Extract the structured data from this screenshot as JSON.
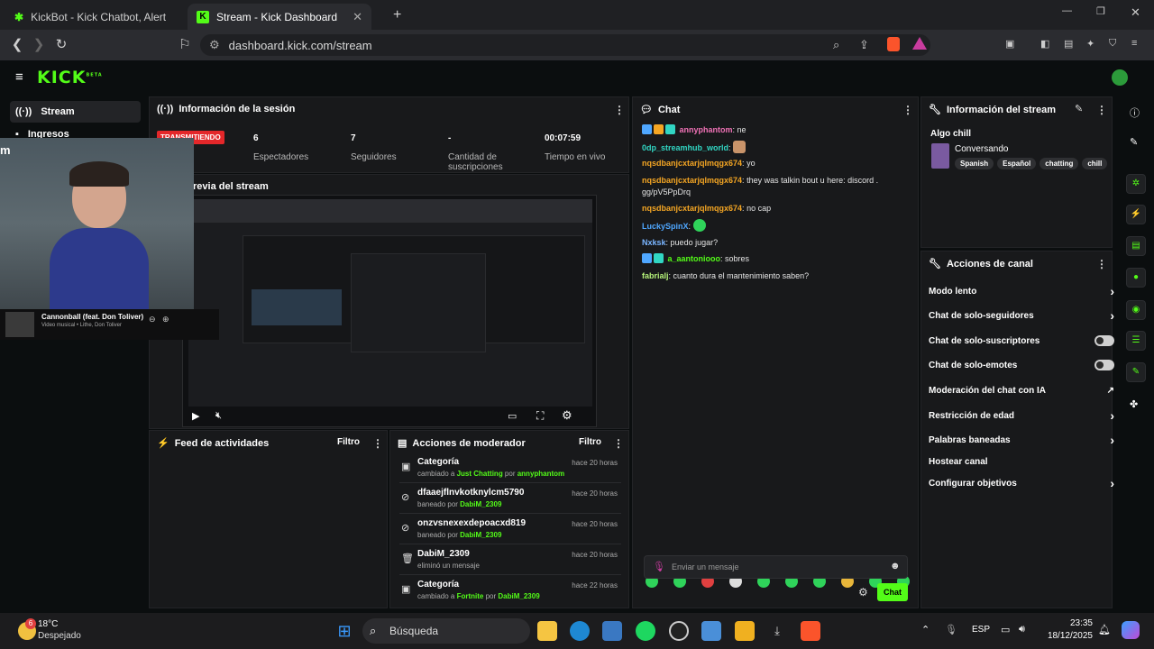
{
  "browser": {
    "tabs": [
      {
        "title": "KickBot - Kick Chatbot, Alerts, TTS, C"
      },
      {
        "title": "Stream - Kick Dashboard"
      }
    ],
    "url": "dashboard.kick.com/stream"
  },
  "brand": {
    "logo": "KICK",
    "beta": "BETA",
    "accent": "#53fc18"
  },
  "sidebar": {
    "items": [
      {
        "label": "Stream",
        "icon": "broadcast-icon"
      },
      {
        "label": "Ingresos",
        "icon": "money-icon"
      }
    ]
  },
  "session": {
    "title": "Información de la sesión",
    "status": "TRANSMITIENDO",
    "stats": [
      {
        "value": "6",
        "label": "Espectadores"
      },
      {
        "value": "7",
        "label": "Seguidores"
      },
      {
        "value": "-",
        "label": "Cantidad de suscripciones"
      },
      {
        "value": "00:07:59",
        "label": "Tiempo en vivo"
      }
    ]
  },
  "preview": {
    "title": "Vista previa del stream",
    "title_visible": "revia del stream"
  },
  "overlay": {
    "label": "m",
    "song": "Cannonball (feat. Don Toliver)",
    "song_sub": "Video musical • Lithe, Don Toliver"
  },
  "activity_feed": {
    "title": "Feed de actividades",
    "filter": "Filtro"
  },
  "mod_actions": {
    "title": "Acciones de moderador",
    "filter": "Filtro",
    "rows": [
      {
        "title": "Categoría",
        "pre": "cambiado a ",
        "target": "Just Chatting",
        "mid": " por ",
        "user": "annyphantom",
        "time": "hace 20 horas",
        "icon": "category-icon"
      },
      {
        "title": "dfaaejflnvkotknylcm5790",
        "pre": "baneado por ",
        "target": "",
        "mid": "",
        "user": "DabiM_2309",
        "time": "hace 20 horas",
        "icon": "ban-icon"
      },
      {
        "title": "onzvsnexexdepoacxd819",
        "pre": "baneado por ",
        "target": "",
        "mid": "",
        "user": "DabiM_2309",
        "time": "hace 20 horas",
        "icon": "ban-icon"
      },
      {
        "title": "DabiM_2309",
        "pre": "eliminó un mensaje",
        "target": "",
        "mid": "",
        "user": "",
        "time": "hace 20 horas",
        "icon": "trash-icon"
      },
      {
        "title": "Categoría",
        "pre": "cambiado a ",
        "target": "Fortnite",
        "mid": " por ",
        "user": "DabiM_2309",
        "time": "hace 22 horas",
        "icon": "category-icon"
      }
    ]
  },
  "chat": {
    "title": "Chat",
    "messages": [
      {
        "user": "annyphantom",
        "text": "ne"
      },
      {
        "user": "0dp_streamhub_world",
        "text": ""
      },
      {
        "user": "nqsdbanjcxtarjqlmqgx674",
        "text": "yo"
      },
      {
        "user": "nqsdbanjcxtarjqlmqgx674",
        "text": "they was talkin bout u here: discord . gg/pV5PpDrq"
      },
      {
        "user": "nqsdbanjcxtarjqlmqgx674",
        "text": "no cap"
      },
      {
        "user": "LuckySpinX",
        "text": ""
      },
      {
        "user": "Nxksk",
        "text": "puedo jugar?"
      },
      {
        "user": "a_aantoniooo",
        "text": "sobres"
      },
      {
        "user": "fabrialj",
        "text": "cuanto dura el mantenimiento saben?"
      }
    ],
    "placeholder": "Enviar un mensaje",
    "send": "Chat"
  },
  "stream_info": {
    "title": "Información del stream",
    "stream_title": "Algo chill",
    "category": "Conversando",
    "tags": [
      "Spanish",
      "Español",
      "chatting",
      "chill"
    ]
  },
  "channel_actions": {
    "title": "Acciones de canal",
    "items": [
      {
        "label": "Modo lento",
        "control": "chevron"
      },
      {
        "label": "Chat de solo-seguidores",
        "control": "chevron"
      },
      {
        "label": "Chat de solo-suscriptores",
        "control": "toggle"
      },
      {
        "label": "Chat de solo-emotes",
        "control": "toggle"
      },
      {
        "label": "Moderación del chat con IA",
        "control": "external"
      },
      {
        "label": "Restricción de edad",
        "control": "chevron"
      },
      {
        "label": "Palabras baneadas",
        "control": "chevron"
      },
      {
        "label": "Hostear canal",
        "control": "none"
      },
      {
        "label": "Configurar objetivos",
        "control": "chevron"
      }
    ]
  },
  "taskbar": {
    "weather_temp": "18°C",
    "weather_desc": "Despejado",
    "weather_badge": "6",
    "search": "Búsqueda",
    "lang": "ESP",
    "time": "23:35",
    "date": "18/12/2025"
  }
}
